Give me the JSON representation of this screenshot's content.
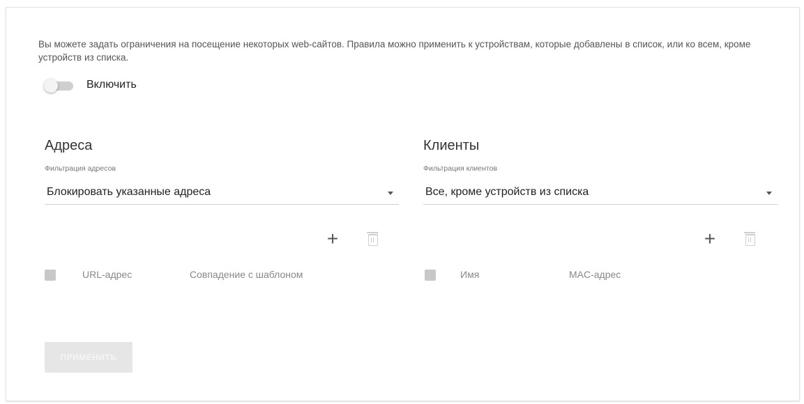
{
  "description": "Вы можете задать ограничения на посещение некоторых web-сайтов. Правила можно применить к устройствам, которые добавлены в список, или ко всем, кроме устройств из списка.",
  "enable": {
    "label": "Включить",
    "checked": false
  },
  "addresses": {
    "title": "Адреса",
    "filter_label": "Фильтрация адресов",
    "filter_value": "Блокировать указанные адреса",
    "columns": [
      "URL-адрес",
      "Совпадение с шаблоном"
    ]
  },
  "clients": {
    "title": "Клиенты",
    "filter_label": "Фильтрация клиентов",
    "filter_value": "Все, кроме устройств из списка",
    "columns": [
      "Имя",
      "MAC-адрес"
    ]
  },
  "apply_button": "ПРИМЕНИТЬ",
  "icons": {
    "add": "plus-icon",
    "delete": "trash-icon",
    "dropdown": "chevron-down-icon"
  }
}
